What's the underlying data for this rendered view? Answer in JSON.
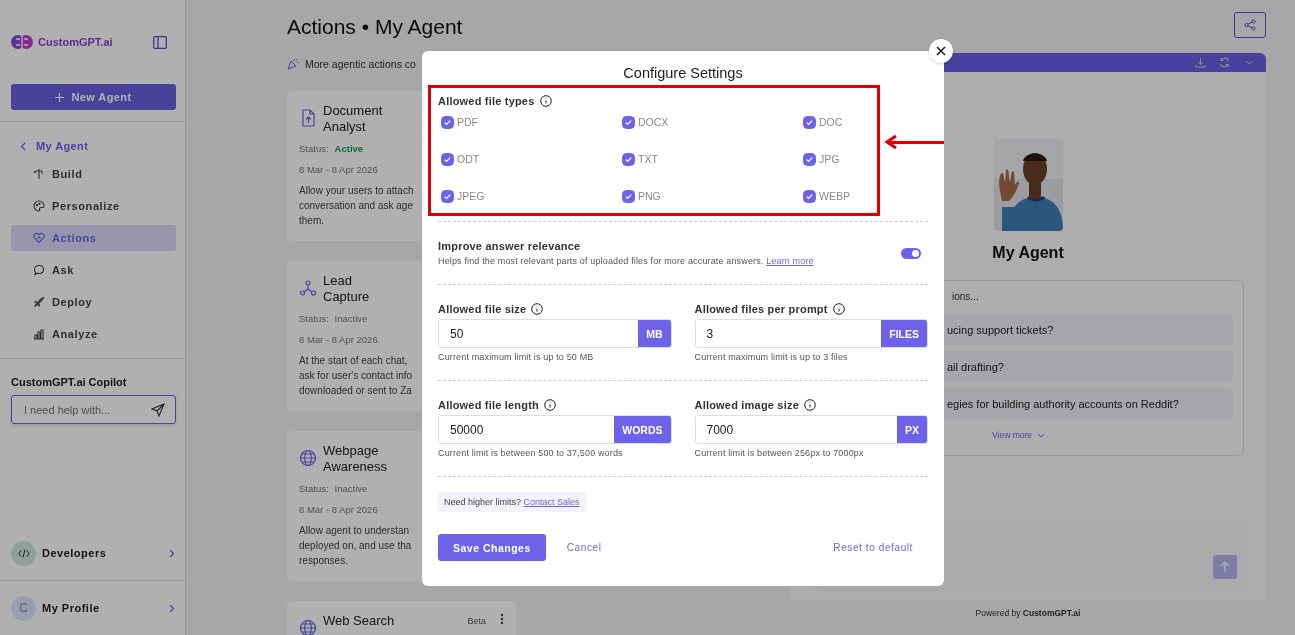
{
  "sidebar": {
    "logo": "CustomGPT.ai",
    "new_agent_button": "New Agent",
    "back_link": "My Agent",
    "nav_items": [
      {
        "kind": "build",
        "label": "Build",
        "selected": false
      },
      {
        "kind": "palette",
        "label": "Personalize",
        "selected": false
      },
      {
        "kind": "heart",
        "label": "Actions",
        "selected": true
      },
      {
        "kind": "chat",
        "label": "Ask",
        "selected": false
      },
      {
        "kind": "rocket",
        "label": "Deploy",
        "selected": false
      },
      {
        "kind": "chart",
        "label": "Analyze",
        "selected": false
      }
    ],
    "copilot": {
      "title": "CustomGPT.ai Copilot",
      "placeholder": "I need help with..."
    },
    "developers": {
      "label": "Developers"
    },
    "profile": {
      "avatar": "C",
      "label": "My Profile"
    }
  },
  "page": {
    "title": "Actions • My Agent",
    "notice": "More agentic actions co"
  },
  "action_cards": [
    {
      "kind": "document",
      "title": "Document Analyst",
      "status_label": "Status:",
      "status": "Active",
      "active": true,
      "dates": "8 Mar - 8 Apr 2026",
      "desc_lines": [
        "Allow your users to attach",
        "conversation and ask age",
        "them."
      ]
    },
    {
      "kind": "lead",
      "title": "Lead Capture",
      "status_label": "Status:",
      "status": "Inactive",
      "active": false,
      "dates": "8 Mar - 8 Apr 2026",
      "desc_lines": [
        "At the start of each chat,",
        "ask for user's contact info",
        "downloaded or sent to Za"
      ]
    },
    {
      "kind": "globe",
      "title": "Webpage Awareness",
      "status_label": "Status:",
      "status": "Inactive",
      "active": false,
      "dates": "8 Mar - 8 Apr 2026",
      "desc_lines": [
        "Allow agent to understan",
        "deployed on, and use tha",
        "responses."
      ]
    },
    {
      "kind": "search",
      "title": "Web Search",
      "badge": "Beta"
    }
  ],
  "preview": {
    "agent_name": "My Agent",
    "suggestions_title": "ions...",
    "suggestions": [
      "ucing support tickets?",
      "ail drafting?",
      "egies for building authority accounts on Reddit?"
    ],
    "view_more": "View more",
    "powered_by": "Powered by **CustomGPT.ai**"
  },
  "modal": {
    "title": "Configure Settings",
    "file_types_label": "Allowed file types",
    "file_types": [
      {
        "label": "PDF",
        "checked": true
      },
      {
        "label": "DOCX",
        "checked": true
      },
      {
        "label": "DOC",
        "checked": true
      },
      {
        "label": "ODT",
        "checked": true
      },
      {
        "label": "TXT",
        "checked": true
      },
      {
        "label": "JPG",
        "checked": true
      },
      {
        "label": "JPEG",
        "checked": true
      },
      {
        "label": "PNG",
        "checked": true
      },
      {
        "label": "WEBP",
        "checked": true
      }
    ],
    "relevance": {
      "title": "Improve answer relevance",
      "text": "Helps find the most relevant parts of uploaded files for more accurate answers.",
      "link": "Learn more",
      "on": true
    },
    "field_rows": [
      [
        {
          "label": "Allowed file size",
          "value": "50",
          "unit": "MB",
          "hint": "Current maximum limit is up to 50 MB"
        },
        {
          "label": "Allowed files per prompt",
          "value": "3",
          "unit": "FILES",
          "hint": "Current maximum limit is up to 3 files"
        }
      ],
      [
        {
          "label": "Allowed file length",
          "value": "50000",
          "unit": "WORDS",
          "hint": "Current limit is between 500 to 37,500 words"
        },
        {
          "label": "Allowed image size",
          "value": "7000",
          "unit": "PX",
          "hint": "Current limit is between 256px to 7000px"
        }
      ]
    ],
    "limits_note": "Need higher limits?",
    "limits_link": "Contact Sales",
    "save_button": "Save Changes",
    "cancel_button": "Cancel",
    "reset_button": "Reset to default"
  }
}
